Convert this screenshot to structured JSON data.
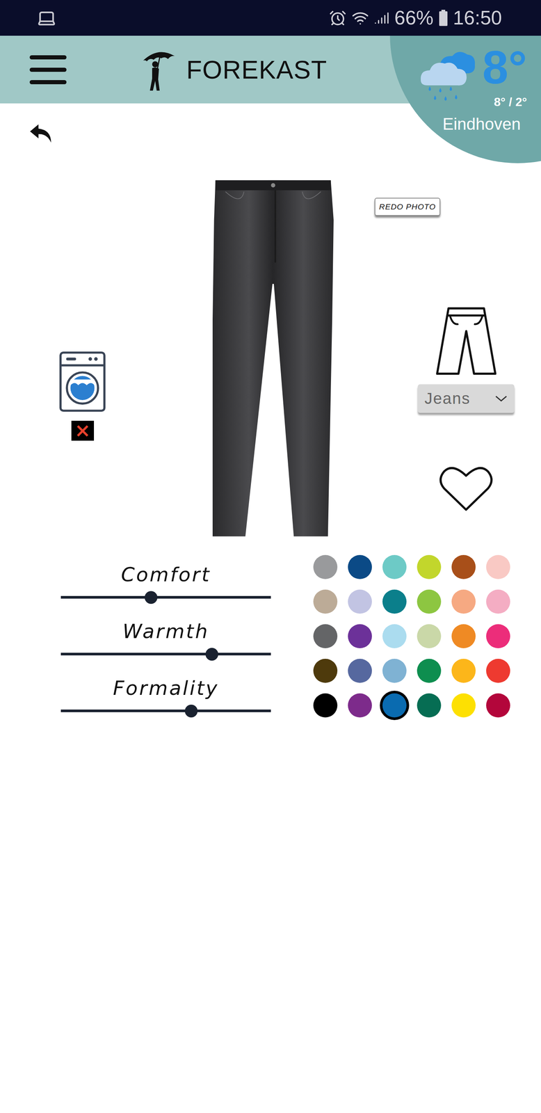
{
  "status_bar": {
    "battery": "66%",
    "time": "16:50"
  },
  "header": {
    "brand": "FOREKAST"
  },
  "weather": {
    "temperature": "8°",
    "range": "8° / 2°",
    "city": "Eindhoven"
  },
  "item": {
    "redo_button": "REDO PHOTO",
    "category": "Jeans",
    "favorite": false,
    "washable": false
  },
  "sliders": [
    {
      "label": "Comfort",
      "level": 0.43
    },
    {
      "label": "Warmth",
      "level": 0.72
    },
    {
      "label": "Formality",
      "level": 0.62
    }
  ],
  "colors": [
    {
      "color": "#999a9c",
      "selected": false
    },
    {
      "color": "#0b4a86",
      "selected": false
    },
    {
      "color": "#6dcac6",
      "selected": false
    },
    {
      "color": "#c2d62c",
      "selected": false
    },
    {
      "color": "#a84f19",
      "selected": false
    },
    {
      "color": "#f9c9c4",
      "selected": false
    },
    {
      "color": "#bcab97",
      "selected": false
    },
    {
      "color": "#c2c4e3",
      "selected": false
    },
    {
      "color": "#0b7f8b",
      "selected": false
    },
    {
      "color": "#8dc641",
      "selected": false
    },
    {
      "color": "#f6a982",
      "selected": false
    },
    {
      "color": "#f4adc3",
      "selected": false
    },
    {
      "color": "#646567",
      "selected": false
    },
    {
      "color": "#6c3199",
      "selected": false
    },
    {
      "color": "#abdcef",
      "selected": false
    },
    {
      "color": "#cad8a8",
      "selected": false
    },
    {
      "color": "#ef8a24",
      "selected": false
    },
    {
      "color": "#ec2d7a",
      "selected": false
    },
    {
      "color": "#4e3a0c",
      "selected": false
    },
    {
      "color": "#56689f",
      "selected": false
    },
    {
      "color": "#7fb2d3",
      "selected": false
    },
    {
      "color": "#0e8e4f",
      "selected": false
    },
    {
      "color": "#fcb61a",
      "selected": false
    },
    {
      "color": "#ee3a30",
      "selected": false
    },
    {
      "color": "#000000",
      "selected": false
    },
    {
      "color": "#7d2b8b",
      "selected": false
    },
    {
      "color": "#0a6bb0",
      "selected": true
    },
    {
      "color": "#066d53",
      "selected": false
    },
    {
      "color": "#fde002",
      "selected": false
    },
    {
      "color": "#b3063b",
      "selected": false
    }
  ]
}
